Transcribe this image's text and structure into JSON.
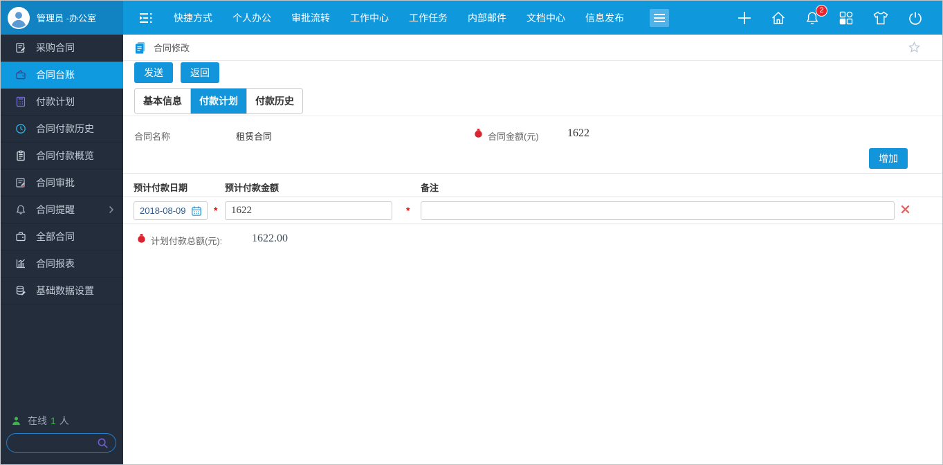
{
  "topbar": {
    "user_name": "管理员 -办公室",
    "menu": [
      "快捷方式",
      "个人办公",
      "审批流转",
      "工作中心",
      "工作任务",
      "内部邮件",
      "文档中心",
      "信息发布"
    ],
    "notification_count": "2"
  },
  "sidebar": {
    "items": [
      {
        "label": "采购合同"
      },
      {
        "label": "合同台账"
      },
      {
        "label": "付款计划"
      },
      {
        "label": "合同付款历史"
      },
      {
        "label": "合同付款概览"
      },
      {
        "label": "合同审批"
      },
      {
        "label": "合同提醒"
      },
      {
        "label": "全部合同"
      },
      {
        "label": "合同报表"
      },
      {
        "label": "基础数据设置"
      }
    ],
    "online_prefix": "在线",
    "online_count": "1",
    "online_suffix": "人"
  },
  "page": {
    "title": "合同修改",
    "send_button": "发送",
    "back_button": "返回",
    "add_button": "增加",
    "tabs": [
      {
        "label": "基本信息"
      },
      {
        "label": "付款计划"
      },
      {
        "label": "付款历史"
      }
    ],
    "form": {
      "name_label": "合同名称",
      "name_value": "租赁合同",
      "amount_label": "合同金额(元)",
      "amount_value": "1622"
    },
    "grid": {
      "headers": [
        "预计付款日期",
        "预计付款金额",
        "备注"
      ],
      "required_mark": "*",
      "rows": [
        {
          "date": "2018-08-09",
          "amount": "1622",
          "remark": ""
        }
      ]
    },
    "total_label": "计划付款总额(元):",
    "total_value": "1622.00"
  },
  "colors": {
    "accent": "#1295db",
    "topbar_blue": "#0f99dc",
    "user_block_blue": "#1283c2",
    "sidebar_bg": "#232d3c",
    "active_item_blue": "#0f9ae0",
    "badge_red": "#e8262d",
    "money_bag_red": "#d9232e",
    "online_green": "#3cb54a",
    "required_red": "#ff0000"
  }
}
